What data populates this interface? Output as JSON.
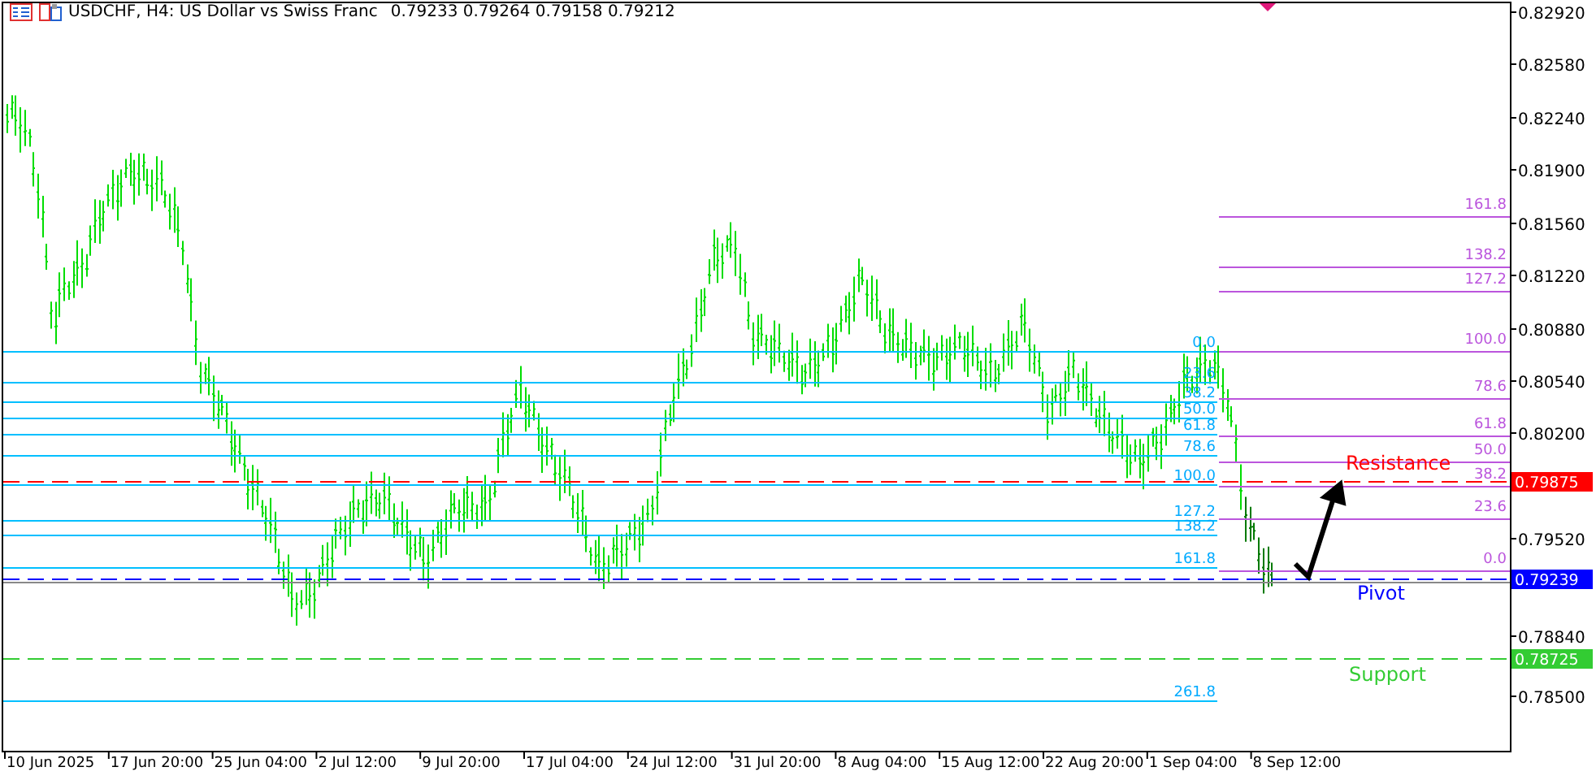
{
  "header": {
    "title": "USDCHF, H4:  US Dollar vs Swiss Franc",
    "ohlc": "0.79233 0.79264 0.79158 0.79212"
  },
  "price_axis": {
    "ticks": [
      "0.82920",
      "0.82580",
      "0.82240",
      "0.81900",
      "0.81560",
      "0.81220",
      "0.80880",
      "0.80540",
      "0.80200",
      "0.79520",
      "0.78840",
      "0.78500"
    ]
  },
  "time_axis": {
    "labels": [
      "10 Jun 2025",
      "17 Jun 20:00",
      "25 Jun 04:00",
      "2 Jul 12:00",
      "9 Jul 20:00",
      "17 Jul 04:00",
      "24 Jul 12:00",
      "31 Jul 20:00",
      "8 Aug 04:00",
      "15 Aug 12:00",
      "22 Aug 20:00",
      "1 Sep 04:00",
      "8 Sep 12:00"
    ]
  },
  "fibo_retracement": {
    "levels": [
      "0.0",
      "23.6",
      "38.2",
      "50.0",
      "61.8",
      "78.6",
      "100.0",
      "127.2",
      "138.2",
      "161.8",
      "261.8"
    ]
  },
  "fibo_expansion": {
    "levels": [
      "161.8",
      "138.2",
      "127.2",
      "100.0",
      "78.6",
      "61.8",
      "50.0",
      "38.2",
      "23.6",
      "0.0"
    ]
  },
  "levels": [
    {
      "label": "Resistance",
      "price_tag": "0.79875",
      "color": "#ff0000"
    },
    {
      "label": "Pivot",
      "price_tag": "0.79239",
      "color": "#0000ff"
    },
    {
      "label": "Support",
      "price_tag": "0.78725",
      "color": "#33cc33"
    }
  ]
}
